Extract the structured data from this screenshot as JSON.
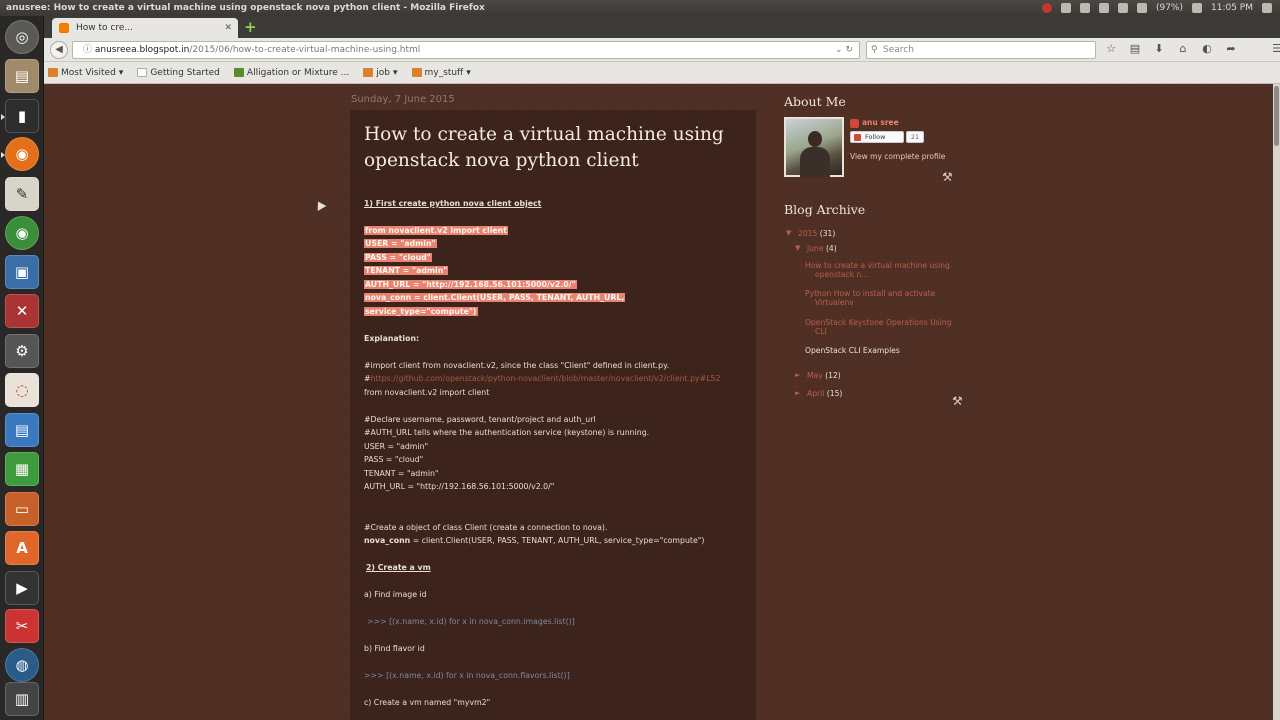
{
  "os_panel": {
    "window_title": "anusree: How to create a virtual machine using openstack nova python client - Mozilla Firefox",
    "battery": "(97%)",
    "clock": "11:05 PM"
  },
  "launcher": {
    "apps": [
      "ubuntu-dash",
      "files",
      "terminal",
      "firefox",
      "text-editor",
      "chrome",
      "virtualbox",
      "gnu-emacs",
      "system-settings",
      "clipboard",
      "writer",
      "calc",
      "impress",
      "software-center",
      "video",
      "tools",
      "network"
    ]
  },
  "browser": {
    "tab_title": "How to cre...",
    "url_host": "anusreea.blogspot.in",
    "url_path": "/2015/06/how-to-create-virtual-machine-using.html",
    "search_placeholder": "Search",
    "bookmarks": {
      "most_visited": "Most Visited",
      "getting_started": "Getting Started",
      "alligation": "Alligation or Mixture ...",
      "job": "job",
      "my_stuff": "my_stuff"
    }
  },
  "post": {
    "date": "Sunday, 7 June 2015",
    "title_l1": "How to create a virtual machine using",
    "title_l2": "openstack nova python client",
    "step1": "1) First create python nova client object",
    "code": [
      "from novaclient.v2 import client",
      "USER = \"admin\"",
      "PASS = \"cloud\"",
      "TENANT = \"admin\"",
      "AUTH_URL = \"http://192.168.56.101:5000/v2.0/\"",
      "nova_conn = client.Client(USER, PASS, TENANT, AUTH_URL,",
      "service_type=\"compute\")"
    ],
    "explanation": "Explanation:",
    "exp1": "#import client from novaclient.v2, since the class \"Client\" defined in client.py.",
    "exp2_prefix": "#",
    "exp2_link": "https://github.com/openstack/python-novaclient/blob/master/novaclient/v2/client.py#L52",
    "exp3": "from novaclient.v2 import client",
    "exp4": "#Declare username, password, tenant/project and auth_url",
    "exp5": "#AUTH_URL tells where the authentication service (keystone) is running.",
    "exp6": "USER = \"admin\"",
    "exp7": "PASS = \"cloud\"",
    "exp8": "TENANT = \"admin\"",
    "exp9": "AUTH_URL = \"http://192.168.56.101:5000/v2.0/\"",
    "exp10": "#Create a object of class Client (create a connection to nova).",
    "exp11_bold": "nova_conn",
    "exp11_rest": " = client.Client(USER, PASS, TENANT, AUTH_URL, service_type=\"compute\")",
    "step2": "2) Create a vm",
    "a": "a) Find image id",
    "a_code": ">>> [(x.name, x.id) for x in nova_conn.images.list()]",
    "b": "b) Find flavor id",
    "b_code": ">>> [(x.name, x.id) for x in nova_conn.flavors.list()]",
    "c": "c) Create a vm named \"myvm2\""
  },
  "sidebar": {
    "about_title": "About Me",
    "profile_name": "anu sree",
    "follow": "Follow",
    "follow_count": "21",
    "view_profile": "View my complete profile",
    "archive_title": "Blog Archive",
    "year": "2015",
    "year_count": "(31)",
    "june": "June",
    "june_count": "(4)",
    "posts": [
      "How to create a virtual machine using",
      "openstack n...",
      "Python How to install and activate",
      "Virtualenv",
      "OpenStack Keystone Operations Using",
      "CLI",
      "OpenStack CLI Examples"
    ],
    "may": "May",
    "may_count": "(12)",
    "april": "April",
    "april_count": "(15)"
  }
}
